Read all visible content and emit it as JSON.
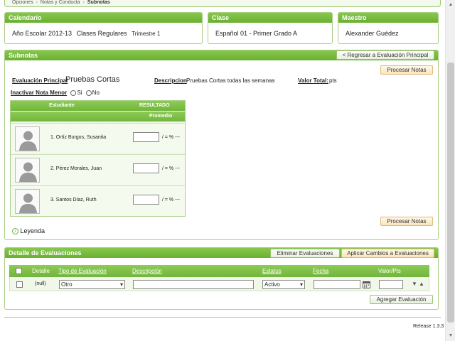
{
  "breadcrumb": {
    "items": [
      "Opciones",
      "Notas y Conducta"
    ],
    "current": "Subnotas"
  },
  "calendario": {
    "header": "Calendario",
    "year": "Año Escolar 2012-13",
    "type": "Clases Regulares",
    "term": "Trimestre 1"
  },
  "clase": {
    "header": "Clase",
    "value": "Español 01 -  Primer Grado  A"
  },
  "maestro": {
    "header": "Maestro",
    "value": "Alexander Guédez"
  },
  "subnotas": {
    "header": "Subnotas",
    "back_button": "< Regresar a Evaluación Principal",
    "process_button": "Procesar Notas",
    "eval_label": "Evaluación Principal",
    "eval_value": "Pruebas Cortas",
    "desc_label": "Descripcion",
    "desc_value": "Pruebas Cortas todas las semanas",
    "valor_label": "Valor Total:",
    "valor_value": "pts",
    "inactivar_label": "Inactivar Nota Menor",
    "radio_si": "Si",
    "radio_no": "No",
    "grid": {
      "col_student": "Estudiante",
      "col_result": "RESULTADO",
      "col_promedio": "Promedio",
      "suffix": "/ = % ---",
      "rows": [
        {
          "name": "1. Ortíz Burgos, Susanita"
        },
        {
          "name": "2. Pérez Morales, Juan"
        },
        {
          "name": "3. Santos Díaz, Ruth"
        }
      ]
    },
    "leyenda": "Leyenda"
  },
  "detalle": {
    "header": "Detalle de Evaluaciones",
    "delete_button": "Eliminar Evaluaciones",
    "apply_button": "Aplicar Cambios a Evaluaciones",
    "columns": {
      "detalle": "Detalle",
      "tipo": "Tipo de Evaluación",
      "descripcion": "Descripción",
      "estatus": "Estatus",
      "fecha": "Fecha",
      "valor": "Valor/Pts"
    },
    "row": {
      "detalle": "(null)",
      "tipo": "Otro",
      "descripcion": "",
      "estatus": "Activo",
      "fecha": "",
      "valor": ""
    },
    "add_button": "Agregar Evaluación"
  },
  "release": "Release 1.3.3",
  "colors": {
    "accent_green": "#72b53c",
    "button_orange": "#fbe4bb"
  },
  "icons": [
    "calendar-icon",
    "arrow-down-icon",
    "arrow-up-icon",
    "expand-icon",
    "avatar-silhouette-icon"
  ]
}
